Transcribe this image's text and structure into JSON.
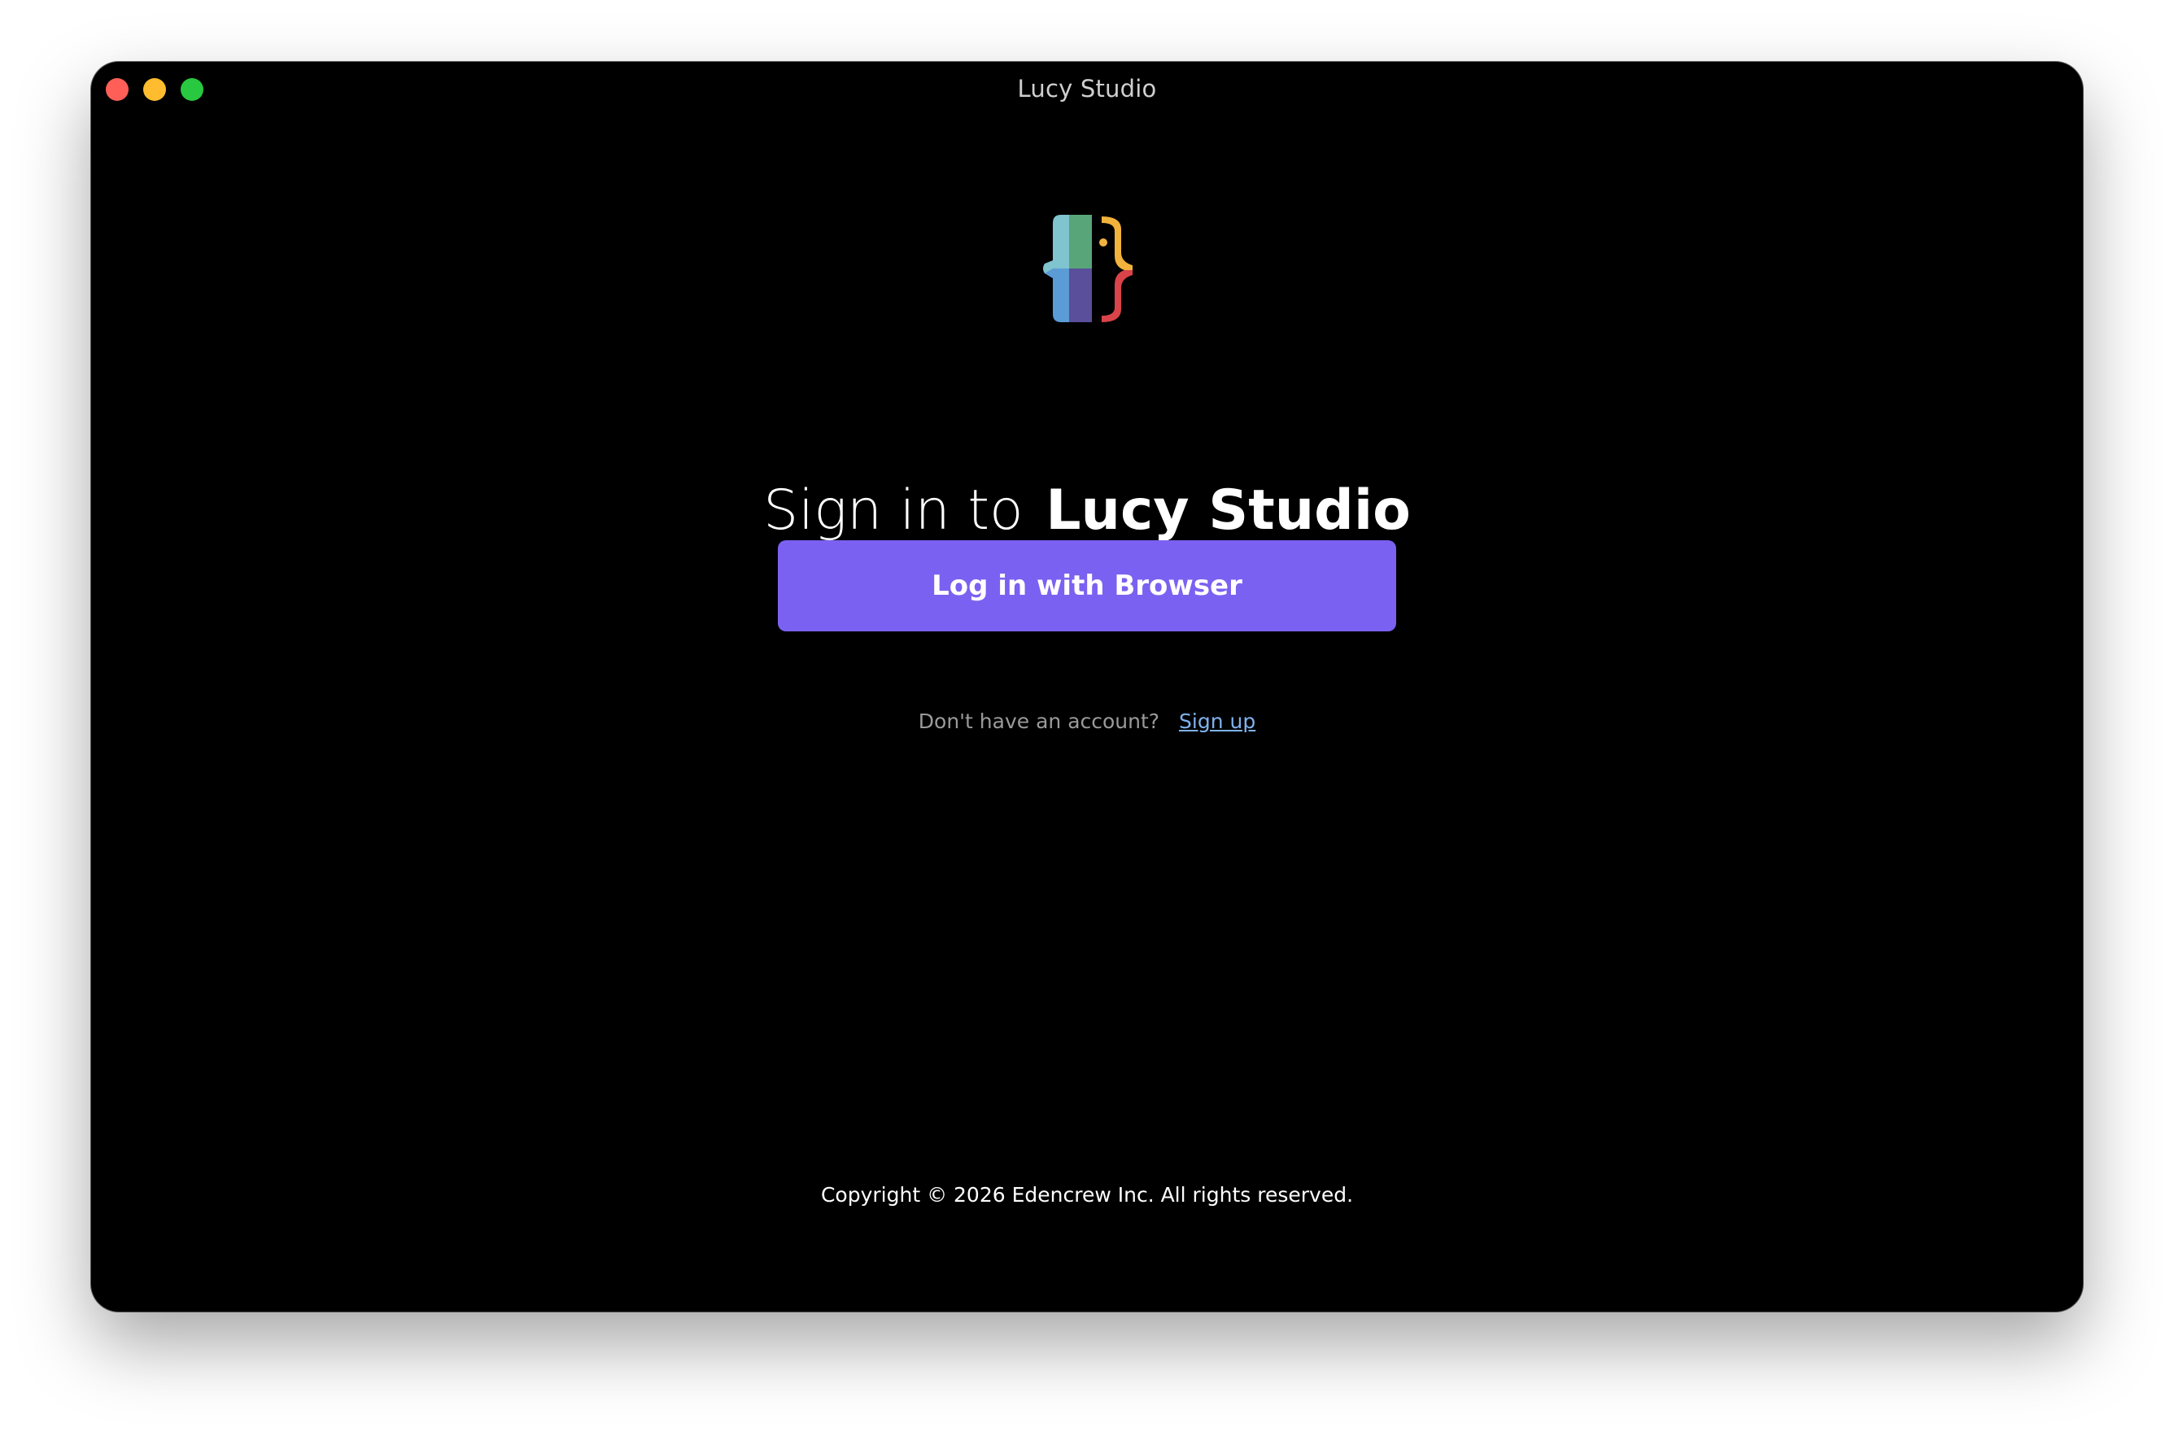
{
  "window": {
    "title": "Lucy Studio"
  },
  "logo": {
    "icon": "lucy-studio-logo-icon",
    "colors": [
      "#7fc4cf",
      "#58a57a",
      "#5b9bd6",
      "#5a4f9a",
      "#f2b33d",
      "#d9434a"
    ]
  },
  "signin": {
    "heading_prefix": "Sign in to",
    "heading_brand": "Lucy Studio",
    "button_label": "Log in with Browser",
    "no_account_text": "Don't have an account?",
    "signup_link": "Sign up"
  },
  "footer": {
    "copyright": "Copyright © 2026 Edencrew Inc. All rights reserved."
  },
  "colors": {
    "background": "#000000",
    "accent": "#7b61f1",
    "link": "#7fb2ee",
    "traffic_close": "#ff5f57",
    "traffic_minimize": "#febc2e",
    "traffic_zoom": "#28c840"
  }
}
